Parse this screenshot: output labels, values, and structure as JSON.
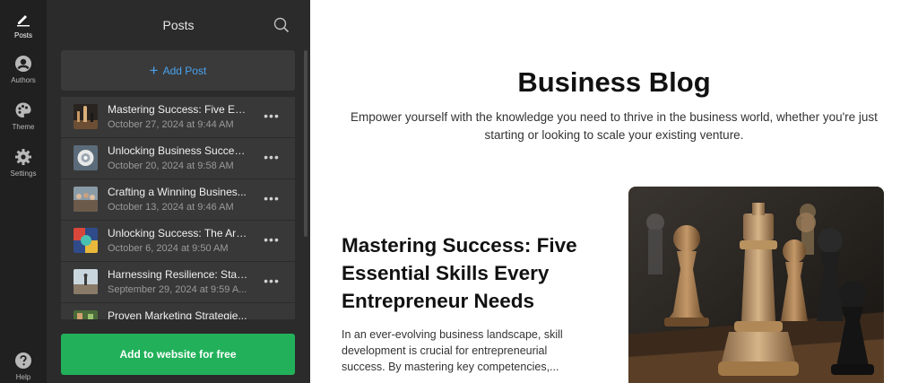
{
  "rail": {
    "items": [
      {
        "label": "Posts",
        "icon": "pencil-icon"
      },
      {
        "label": "Authors",
        "icon": "user-icon"
      },
      {
        "label": "Theme",
        "icon": "palette-icon"
      },
      {
        "label": "Settings",
        "icon": "gear-icon"
      },
      {
        "label": "Help",
        "icon": "question-icon"
      }
    ]
  },
  "panel": {
    "title": "Posts",
    "add_post_label": "Add Post",
    "posts": [
      {
        "title": "Mastering Success: Five Ess...",
        "date": "October 27, 2024 at 9:44 AM"
      },
      {
        "title": "Unlocking Business Success...",
        "date": "October 20, 2024 at 9:58 AM"
      },
      {
        "title": "Crafting a Winning Busines...",
        "date": "October 13, 2024 at 9:46 AM"
      },
      {
        "title": "Unlocking Success: The Art ...",
        "date": "October 6, 2024 at 9:50 AM"
      },
      {
        "title": "Harnessing Resilience: Stayi...",
        "date": "September 29, 2024 at 9:59 A..."
      },
      {
        "title": "Proven Marketing Strategie...",
        "date": ""
      }
    ],
    "more_glyph": "•••",
    "cta_label": "Add to website for free"
  },
  "main": {
    "blog_title": "Business Blog",
    "blog_subtitle": "Empower yourself with the knowledge you need to thrive in the business world, whether you're just starting or looking to scale your existing venture.",
    "featured": {
      "title": "Mastering Success: Five Essential Skills Every Entrepreneur Needs",
      "excerpt": "In an ever-evolving business landscape, skill development is crucial for entrepreneurial success. By mastering key competencies,..."
    }
  },
  "colors": {
    "rail_bg": "#202020",
    "panel_bg": "#2b2b2b",
    "row_bg": "#383838",
    "accent_blue": "#4aa3f0",
    "cta_green": "#22b15a"
  }
}
